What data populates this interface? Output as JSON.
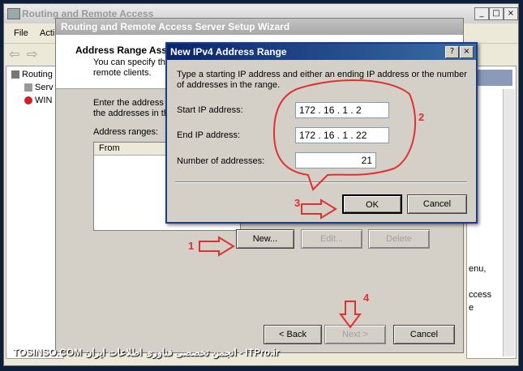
{
  "main_window": {
    "title": "Routing and Remote Access",
    "menu": [
      "File",
      "Actio"
    ]
  },
  "tree": {
    "items": [
      "Routing",
      "Serv",
      "WIN"
    ]
  },
  "right_pane": {
    "text_lines": [
      "enu,",
      "ccess",
      "e"
    ]
  },
  "wizard": {
    "title": "Routing and Remote Access Server Setup Wizard",
    "header_title": "Address Range Assi",
    "header_text_1": "You can specify th",
    "header_text_2": "remote clients.",
    "body_text_1": "Enter the address ra",
    "body_text_2": "the addresses in th",
    "ranges_label": "Address ranges:",
    "column_from": "From",
    "new_label": "New...",
    "edit_label": "Edit...",
    "delete_label": "Delete",
    "back_label": "< Back",
    "next_label": "Next >",
    "cancel_label": "Cancel"
  },
  "dialog": {
    "title": "New IPv4 Address Range",
    "help_glyph": "?",
    "close_glyph": "×",
    "instructions": "Type a starting IP address and either an ending IP address or the number of addresses in the range.",
    "start_label": "Start IP address:",
    "start_value": "172 . 16 . 1 . 2",
    "end_label": "End IP address:",
    "end_value": "172 . 16 . 1 . 22",
    "count_label": "Number of addresses:",
    "count_value": "21",
    "ok_label": "OK",
    "cancel_label": "Cancel"
  },
  "annotations": {
    "step1": "1",
    "step2": "2",
    "step3": "3",
    "step4": "4",
    "color": "#e03030"
  },
  "footer": {
    "watermark": "TOSINSO.COM  انجمن تخصصی فناوری اطلاعات ایران - ITPro.ir"
  }
}
